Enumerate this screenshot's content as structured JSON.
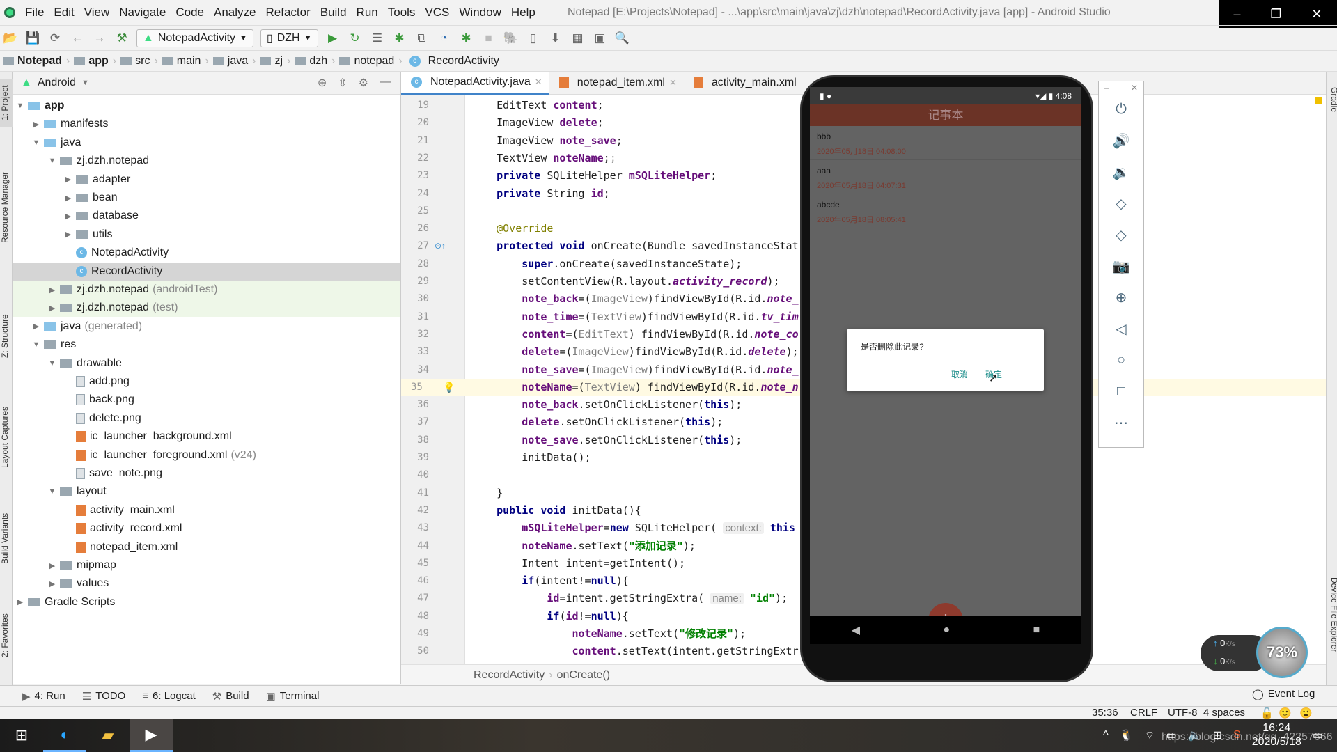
{
  "menu": {
    "items": [
      "File",
      "Edit",
      "View",
      "Navigate",
      "Code",
      "Analyze",
      "Refactor",
      "Build",
      "Run",
      "Tools",
      "VCS",
      "Window",
      "Help"
    ],
    "title": "Notepad [E:\\Projects\\Notepad] - ...\\app\\src\\main\\java\\zj\\dzh\\notepad\\RecordActivity.java [app] - Android Studio"
  },
  "toolbar": {
    "run_config": "NotepadActivity",
    "device": "DZH"
  },
  "breadcrumb": [
    "Notepad",
    "app",
    "src",
    "main",
    "java",
    "zj",
    "dzh",
    "notepad",
    "RecordActivity"
  ],
  "left_stripe": [
    "1: Project",
    "Resource Manager",
    "Z: Structure",
    "Layout Captures",
    "Build Variants",
    "2: Favorites"
  ],
  "project": {
    "view": "Android",
    "tree": [
      {
        "l": 0,
        "a": "open",
        "i": "src",
        "t": "app",
        "b": true
      },
      {
        "l": 1,
        "a": "closed",
        "i": "src",
        "t": "manifests"
      },
      {
        "l": 1,
        "a": "open",
        "i": "src",
        "t": "java"
      },
      {
        "l": 2,
        "a": "open",
        "i": "folder",
        "t": "zj.dzh.notepad"
      },
      {
        "l": 3,
        "a": "closed",
        "i": "folder",
        "t": "adapter"
      },
      {
        "l": 3,
        "a": "closed",
        "i": "folder",
        "t": "bean"
      },
      {
        "l": 3,
        "a": "closed",
        "i": "folder",
        "t": "database"
      },
      {
        "l": 3,
        "a": "closed",
        "i": "folder",
        "t": "utils"
      },
      {
        "l": 3,
        "a": "",
        "i": "class",
        "t": "NotepadActivity"
      },
      {
        "l": 3,
        "a": "",
        "i": "class",
        "t": "RecordActivity",
        "sel": true
      },
      {
        "l": 2,
        "a": "closed",
        "i": "folder",
        "t": "zj.dzh.notepad",
        "s": "(androidTest)",
        "test": true
      },
      {
        "l": 2,
        "a": "closed",
        "i": "folder",
        "t": "zj.dzh.notepad",
        "s": "(test)",
        "test": true
      },
      {
        "l": 1,
        "a": "closed",
        "i": "src",
        "t": "java",
        "s": "(generated)"
      },
      {
        "l": 1,
        "a": "open",
        "i": "folder",
        "t": "res"
      },
      {
        "l": 2,
        "a": "open",
        "i": "folder",
        "t": "drawable"
      },
      {
        "l": 3,
        "a": "",
        "i": "file",
        "t": "add.png"
      },
      {
        "l": 3,
        "a": "",
        "i": "file",
        "t": "back.png"
      },
      {
        "l": 3,
        "a": "",
        "i": "file",
        "t": "delete.png"
      },
      {
        "l": 3,
        "a": "",
        "i": "xml",
        "t": "ic_launcher_background.xml"
      },
      {
        "l": 3,
        "a": "",
        "i": "xml",
        "t": "ic_launcher_foreground.xml",
        "s": "(v24)"
      },
      {
        "l": 3,
        "a": "",
        "i": "file",
        "t": "save_note.png"
      },
      {
        "l": 2,
        "a": "open",
        "i": "folder",
        "t": "layout"
      },
      {
        "l": 3,
        "a": "",
        "i": "xml",
        "t": "activity_main.xml"
      },
      {
        "l": 3,
        "a": "",
        "i": "xml",
        "t": "activity_record.xml"
      },
      {
        "l": 3,
        "a": "",
        "i": "xml",
        "t": "notepad_item.xml"
      },
      {
        "l": 2,
        "a": "closed",
        "i": "folder",
        "t": "mipmap"
      },
      {
        "l": 2,
        "a": "closed",
        "i": "folder",
        "t": "values"
      },
      {
        "l": 0,
        "a": "closed",
        "i": "folder",
        "t": "Gradle Scripts"
      }
    ]
  },
  "tabs": [
    "NotepadActivity.java",
    "notepad_item.xml",
    "activity_main.xml"
  ],
  "editor": {
    "current_line": 35,
    "lines": [
      {
        "n": 19,
        "t": [
          [
            "    EditText ",
            ""
          ],
          [
            "content",
            "fld"
          ],
          [
            ";",
            ""
          ]
        ]
      },
      {
        "n": 20,
        "t": [
          [
            "    ImageView ",
            ""
          ],
          [
            "delete",
            "fld"
          ],
          [
            ";",
            ""
          ]
        ]
      },
      {
        "n": 21,
        "t": [
          [
            "    ImageView ",
            ""
          ],
          [
            "note_save",
            "fld"
          ],
          [
            ";",
            ""
          ]
        ]
      },
      {
        "n": 22,
        "t": [
          [
            "    TextView ",
            ""
          ],
          [
            "noteName",
            "fld"
          ],
          [
            ";",
            ""
          ],
          [
            ";",
            "semi"
          ]
        ]
      },
      {
        "n": 23,
        "t": [
          [
            "    ",
            ""
          ],
          [
            "private",
            "kw"
          ],
          [
            " SQLiteHelper ",
            ""
          ],
          [
            "mSQLiteHelper",
            "fld"
          ],
          [
            ";",
            ""
          ]
        ]
      },
      {
        "n": 24,
        "t": [
          [
            "    ",
            ""
          ],
          [
            "private",
            "kw"
          ],
          [
            " String ",
            ""
          ],
          [
            "id",
            "fld"
          ],
          [
            ";",
            ""
          ]
        ]
      },
      {
        "n": 25,
        "t": []
      },
      {
        "n": 26,
        "t": [
          [
            "    ",
            ""
          ],
          [
            "@Override",
            "ann"
          ]
        ]
      },
      {
        "n": 27,
        "t": [
          [
            "    ",
            ""
          ],
          [
            "protected void",
            "kw"
          ],
          [
            " onCreate(Bundle savedInstanceStat",
            ""
          ]
        ]
      },
      {
        "n": 28,
        "t": [
          [
            "        ",
            ""
          ],
          [
            "super",
            "kw"
          ],
          [
            ".onCreate(savedInstanceState);",
            ""
          ]
        ]
      },
      {
        "n": 29,
        "t": [
          [
            "        setContentView(R.layout.",
            ""
          ],
          [
            "activity_record",
            "ital"
          ],
          [
            ");",
            ""
          ]
        ]
      },
      {
        "n": 30,
        "t": [
          [
            "        ",
            ""
          ],
          [
            "note_back",
            "fld"
          ],
          [
            "=(",
            ""
          ],
          [
            "ImageView",
            "cast"
          ],
          [
            ")findViewById(R.id.",
            ""
          ],
          [
            "note_",
            "ital"
          ]
        ]
      },
      {
        "n": 31,
        "t": [
          [
            "        ",
            ""
          ],
          [
            "note_time",
            "fld"
          ],
          [
            "=(",
            ""
          ],
          [
            "TextView",
            "cast"
          ],
          [
            ")findViewById(R.id.",
            ""
          ],
          [
            "tv_tim",
            "ital"
          ]
        ]
      },
      {
        "n": 32,
        "t": [
          [
            "        ",
            ""
          ],
          [
            "content",
            "fld"
          ],
          [
            "=(",
            ""
          ],
          [
            "EditText",
            "cast"
          ],
          [
            ") findViewById(R.id.",
            ""
          ],
          [
            "note_co",
            "ital"
          ]
        ]
      },
      {
        "n": 33,
        "t": [
          [
            "        ",
            ""
          ],
          [
            "delete",
            "fld"
          ],
          [
            "=(",
            ""
          ],
          [
            "ImageView",
            "cast"
          ],
          [
            ")findViewById(R.id.",
            ""
          ],
          [
            "delete",
            "ital"
          ],
          [
            ");",
            ""
          ]
        ]
      },
      {
        "n": 34,
        "t": [
          [
            "        ",
            ""
          ],
          [
            "note_save",
            "fld"
          ],
          [
            "=(",
            ""
          ],
          [
            "ImageView",
            "cast"
          ],
          [
            ")findViewById(R.id.",
            ""
          ],
          [
            "note_",
            "ital"
          ]
        ]
      },
      {
        "n": 35,
        "t": [
          [
            "        ",
            ""
          ],
          [
            "noteName",
            "fld"
          ],
          [
            "=(",
            ""
          ],
          [
            "TextView",
            "cast"
          ],
          [
            ") findViewById(R.id.",
            ""
          ],
          [
            "note_n",
            "ital"
          ]
        ]
      },
      {
        "n": 36,
        "t": [
          [
            "        ",
            ""
          ],
          [
            "note_back",
            "fld"
          ],
          [
            ".setOnClickListener(",
            ""
          ],
          [
            "this",
            "kw"
          ],
          [
            ");",
            ""
          ]
        ]
      },
      {
        "n": 37,
        "t": [
          [
            "        ",
            ""
          ],
          [
            "delete",
            "fld"
          ],
          [
            ".setOnClickListener(",
            ""
          ],
          [
            "this",
            "kw"
          ],
          [
            ");",
            ""
          ]
        ]
      },
      {
        "n": 38,
        "t": [
          [
            "        ",
            ""
          ],
          [
            "note_save",
            "fld"
          ],
          [
            ".setOnClickListener(",
            ""
          ],
          [
            "this",
            "kw"
          ],
          [
            ");",
            ""
          ]
        ]
      },
      {
        "n": 39,
        "t": [
          [
            "        initData();",
            ""
          ]
        ]
      },
      {
        "n": 40,
        "t": []
      },
      {
        "n": 41,
        "t": [
          [
            "    }",
            ""
          ]
        ]
      },
      {
        "n": 42,
        "t": [
          [
            "    ",
            ""
          ],
          [
            "public void",
            "kw"
          ],
          [
            " initData(){",
            ""
          ]
        ]
      },
      {
        "n": 43,
        "t": [
          [
            "        ",
            ""
          ],
          [
            "mSQLiteHelper",
            "fld"
          ],
          [
            "=",
            ""
          ],
          [
            "new",
            "kw"
          ],
          [
            " SQLiteHelper( ",
            ""
          ],
          [
            "context:",
            "hint"
          ],
          [
            " ",
            ""
          ],
          [
            "this",
            "kw"
          ]
        ]
      },
      {
        "n": 44,
        "t": [
          [
            "        ",
            ""
          ],
          [
            "noteName",
            "fld"
          ],
          [
            ".setText(",
            ""
          ],
          [
            "\"添加记录\"",
            "str"
          ],
          [
            ");",
            ""
          ]
        ]
      },
      {
        "n": 45,
        "t": [
          [
            "        Intent intent=getIntent();",
            ""
          ]
        ]
      },
      {
        "n": 46,
        "t": [
          [
            "        ",
            ""
          ],
          [
            "if",
            "kw"
          ],
          [
            "(intent!=",
            ""
          ],
          [
            "null",
            "kw"
          ],
          [
            "){",
            ""
          ]
        ]
      },
      {
        "n": 47,
        "t": [
          [
            "            ",
            ""
          ],
          [
            "id",
            "fld"
          ],
          [
            "=intent.getStringExtra( ",
            ""
          ],
          [
            "name:",
            "hint"
          ],
          [
            " ",
            ""
          ],
          [
            "\"id\"",
            "str"
          ],
          [
            ");",
            ""
          ]
        ]
      },
      {
        "n": 48,
        "t": [
          [
            "            ",
            ""
          ],
          [
            "if",
            "kw"
          ],
          [
            "(",
            ""
          ],
          [
            "id",
            "fld"
          ],
          [
            "!=",
            ""
          ],
          [
            "null",
            "kw"
          ],
          [
            "){",
            ""
          ]
        ]
      },
      {
        "n": 49,
        "t": [
          [
            "                ",
            ""
          ],
          [
            "noteName",
            "fld"
          ],
          [
            ".setText(",
            ""
          ],
          [
            "\"修改记录\"",
            "str"
          ],
          [
            ");",
            ""
          ]
        ]
      },
      {
        "n": 50,
        "t": [
          [
            "                ",
            ""
          ],
          [
            "content",
            "fld"
          ],
          [
            ".setText(intent.getStringExtr",
            ""
          ]
        ]
      }
    ]
  },
  "editor_breadcrumb": [
    "RecordActivity",
    "onCreate()"
  ],
  "phone": {
    "time": "4:08",
    "app_title": "记事本",
    "notes": [
      {
        "name": "bbb",
        "date": "2020年05月18日 04:08:00"
      },
      {
        "name": "aaa",
        "date": "2020年05月18日 04:07:31"
      },
      {
        "name": "abcde",
        "date": "2020年05月18日 08:05:41"
      }
    ],
    "dialog": {
      "message": "是否删除此记录?",
      "cancel": "取消",
      "confirm": "确定"
    },
    "fab": "+"
  },
  "emulator_controls": [
    "power-icon",
    "volume-up-icon",
    "volume-down-icon",
    "rotate-left-icon",
    "rotate-right-icon",
    "camera-icon",
    "zoom-icon",
    "back-icon",
    "home-icon",
    "overview-icon",
    "more-icon"
  ],
  "bottom_tools": [
    "4: Run",
    "TODO",
    "6: Logcat",
    "Build",
    "Terminal"
  ],
  "event_log": "Event Log",
  "status": {
    "position": "35:36",
    "line_sep": "CRLF",
    "encoding": "UTF-8",
    "indent": "4 spaces"
  },
  "network": {
    "up": "0",
    "down": "0",
    "unit": "K/s",
    "percent": "73%"
  },
  "clock": {
    "time": "16:24",
    "date": "2020/5/18"
  },
  "watermark": "https://blog.csdn.net/qq_42257666",
  "right_stripe": [
    "Gradle",
    "Device File Explorer"
  ]
}
